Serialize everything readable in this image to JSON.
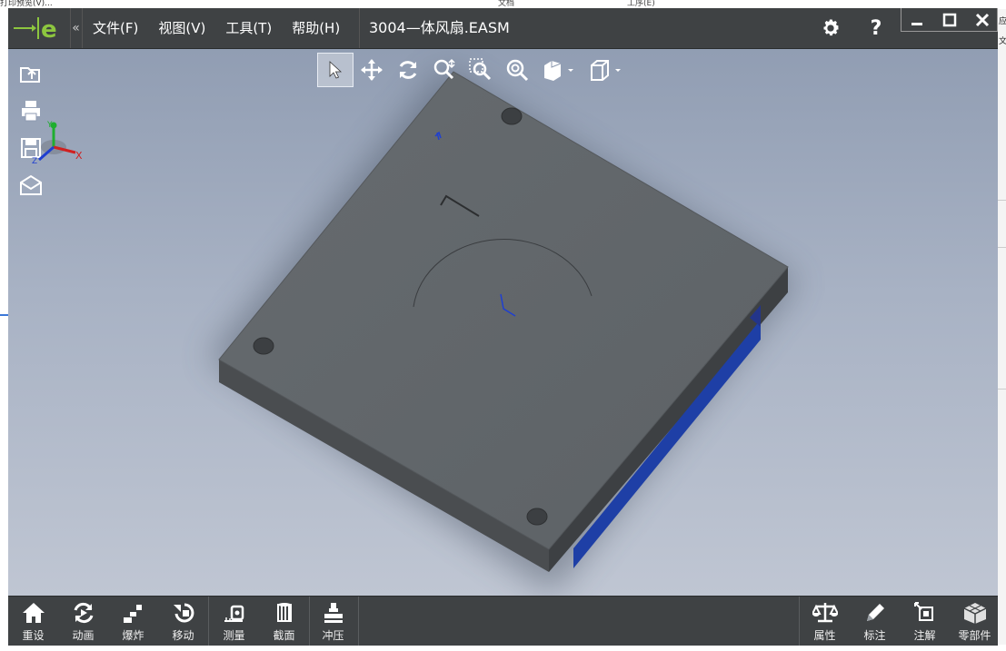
{
  "background": {
    "top_left_text": "打印预览(V)...",
    "tab1_text": "文档",
    "tab2_text": "工序(E)",
    "right_edge_text1": "应",
    "right_edge_text2": "文"
  },
  "titlebar": {
    "menu": [
      "文件(F)",
      "视图(V)",
      "工具(T)",
      "帮助(H)"
    ],
    "document_title": "3004—体风扇.EASM",
    "collapse_glyph": "«"
  },
  "view_toolbar": {
    "tools": [
      "select-icon",
      "pan-icon",
      "rotate-icon",
      "zoom-icon",
      "zoom-area-icon",
      "zoom-fit-icon",
      "render-mode-icon",
      "view-cube-icon"
    ]
  },
  "left_tools": [
    "open-icon",
    "print-icon",
    "save-icon",
    "email-icon"
  ],
  "axis": {
    "x": "X",
    "y": "Y",
    "z": "Z"
  },
  "bottom_toolbar": {
    "group1": [
      "重设",
      "动画",
      "爆炸",
      "移动"
    ],
    "group2": [
      "测量",
      "截面"
    ],
    "group3": [
      "冲压"
    ],
    "right_group": [
      "属性",
      "标注",
      "注解",
      "零部件"
    ]
  },
  "colors": {
    "chrome": "#3f4244",
    "accent": "#8dc63f",
    "model_face": "#61666a",
    "model_side": "#46494c",
    "highlight_blue": "#1e3fa6"
  }
}
